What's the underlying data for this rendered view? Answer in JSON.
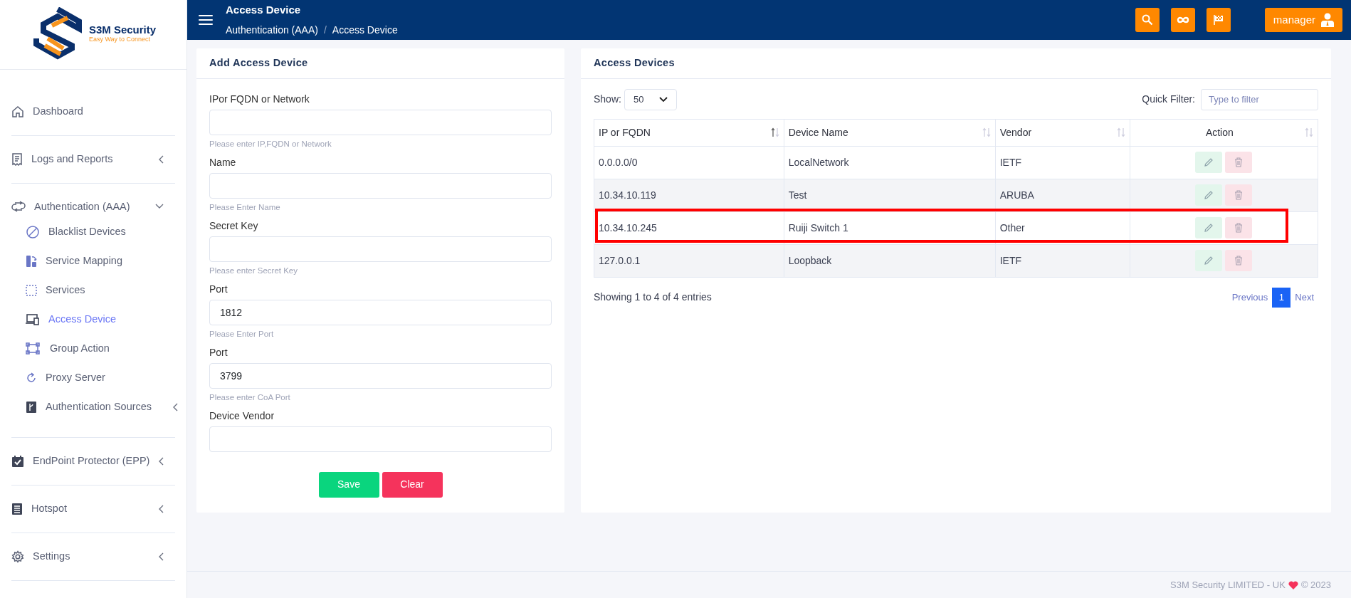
{
  "logo": {
    "name": "S3M Security",
    "tagline": "Easy Way to Connect"
  },
  "topbar": {
    "title": "Access Device",
    "breadcrumb": [
      "Authentication (AAA)",
      "Access Device"
    ],
    "breadcrumb_separator": "/",
    "user_button": "manager"
  },
  "sidebar": {
    "items": [
      {
        "label": "Dashboard"
      },
      {
        "label": "Logs and Reports",
        "expanded": false
      },
      {
        "label": "Authentication (AAA)",
        "expanded": true,
        "children": [
          {
            "label": "Blacklist Devices",
            "selected": false
          },
          {
            "label": "Service Mapping",
            "selected": false
          },
          {
            "label": "Services",
            "selected": false
          },
          {
            "label": "Access Device",
            "selected": true
          },
          {
            "label": "Group Action",
            "selected": false
          },
          {
            "label": "Proxy Server",
            "selected": false
          },
          {
            "label": "Authentication Sources",
            "selected": false,
            "expanded": false
          }
        ]
      },
      {
        "label": "EndPoint Protector (EPP)",
        "expanded": false
      },
      {
        "label": "Hotspot",
        "expanded": false
      },
      {
        "label": "Settings",
        "expanded": false
      }
    ]
  },
  "form": {
    "title": "Add Access Device",
    "fields": [
      {
        "label": "IPor FQDN or Network",
        "help": "Please enter IP,FQDN or Network"
      },
      {
        "label": "Name",
        "help": "Please Enter Name"
      },
      {
        "label": "Secret Key",
        "help": "Please enter Secret Key"
      },
      {
        "label": "Port",
        "value": "1812",
        "help": "Please Enter Port"
      },
      {
        "label": "Port",
        "value": "3799",
        "help": "Please enter CoA Port"
      },
      {
        "label": "Device Vendor"
      }
    ],
    "buttons": [
      {
        "label": "Save",
        "kind": "success"
      },
      {
        "label": "Clear",
        "kind": "danger"
      }
    ]
  },
  "table_card": {
    "title": "Access Devices",
    "show_label": "Show:",
    "show_value": "50",
    "filter_label": "Quick Filter:",
    "filter_placeholder": "Type to filter",
    "columns": [
      {
        "label": "IP or FQDN",
        "sorted_ascending": true
      },
      {
        "label": "Device Name",
        "sorted_ascending": false
      },
      {
        "label": "Vendor",
        "sorted_ascending": false
      },
      {
        "label": "Action",
        "sorted_ascending": false
      }
    ],
    "rows": [
      {
        "cells": [
          "0.0.0.0/0",
          "LocalNetwork",
          "IETF"
        ],
        "highlighted": false
      },
      {
        "cells": [
          "10.34.10.119",
          "Test",
          "ARUBA"
        ],
        "highlighted": false
      },
      {
        "cells": [
          "10.34.10.245",
          "Ruiji Switch 1",
          "Other"
        ],
        "highlighted": true
      },
      {
        "cells": [
          "127.0.0.1",
          "Loopback",
          "IETF"
        ],
        "highlighted": false
      }
    ],
    "info": "Showing 1 to 4 of 4 entries",
    "pagination": [
      {
        "label": "Previous",
        "kind": "link",
        "selected": false
      },
      {
        "label": "1",
        "kind": "page",
        "selected": true
      },
      {
        "label": "Next",
        "kind": "link",
        "selected": false
      }
    ]
  },
  "footer": {
    "company": "S3M Security LIMITED - UK",
    "year": "© 2023"
  }
}
